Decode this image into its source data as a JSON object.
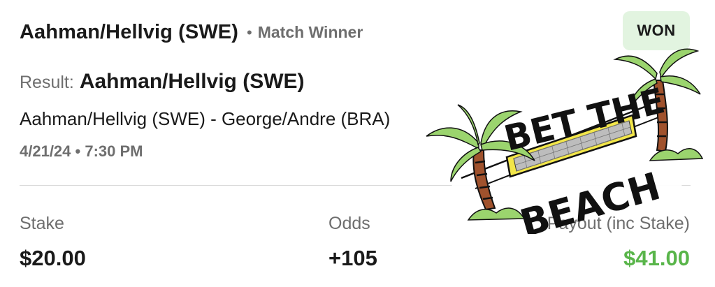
{
  "bet": {
    "selection": "Aahman/Hellvig (SWE)",
    "separator": "•",
    "market": "Match Winner",
    "status": "WON",
    "result_label": "Result:",
    "result_value": "Aahman/Hellvig (SWE)",
    "event": "Aahman/Hellvig (SWE) - George/Andre (BRA)",
    "datetime": "4/21/24 • 7:30 PM"
  },
  "summary": {
    "stake_label": "Stake",
    "stake_value": "$20.00",
    "odds_label": "Odds",
    "odds_value": "+105",
    "payout_label": "Payout (inc Stake)",
    "payout_value": "$41.00"
  },
  "logo": {
    "line1": "BET THE",
    "line2": "BEACH"
  },
  "colors": {
    "won_badge_bg": "#e2f4e0",
    "payout_green": "#59b54a",
    "secondary_text": "#6e6e6e",
    "palm_leaf": "#9bd46e",
    "net_yellow": "#f2e64a"
  }
}
